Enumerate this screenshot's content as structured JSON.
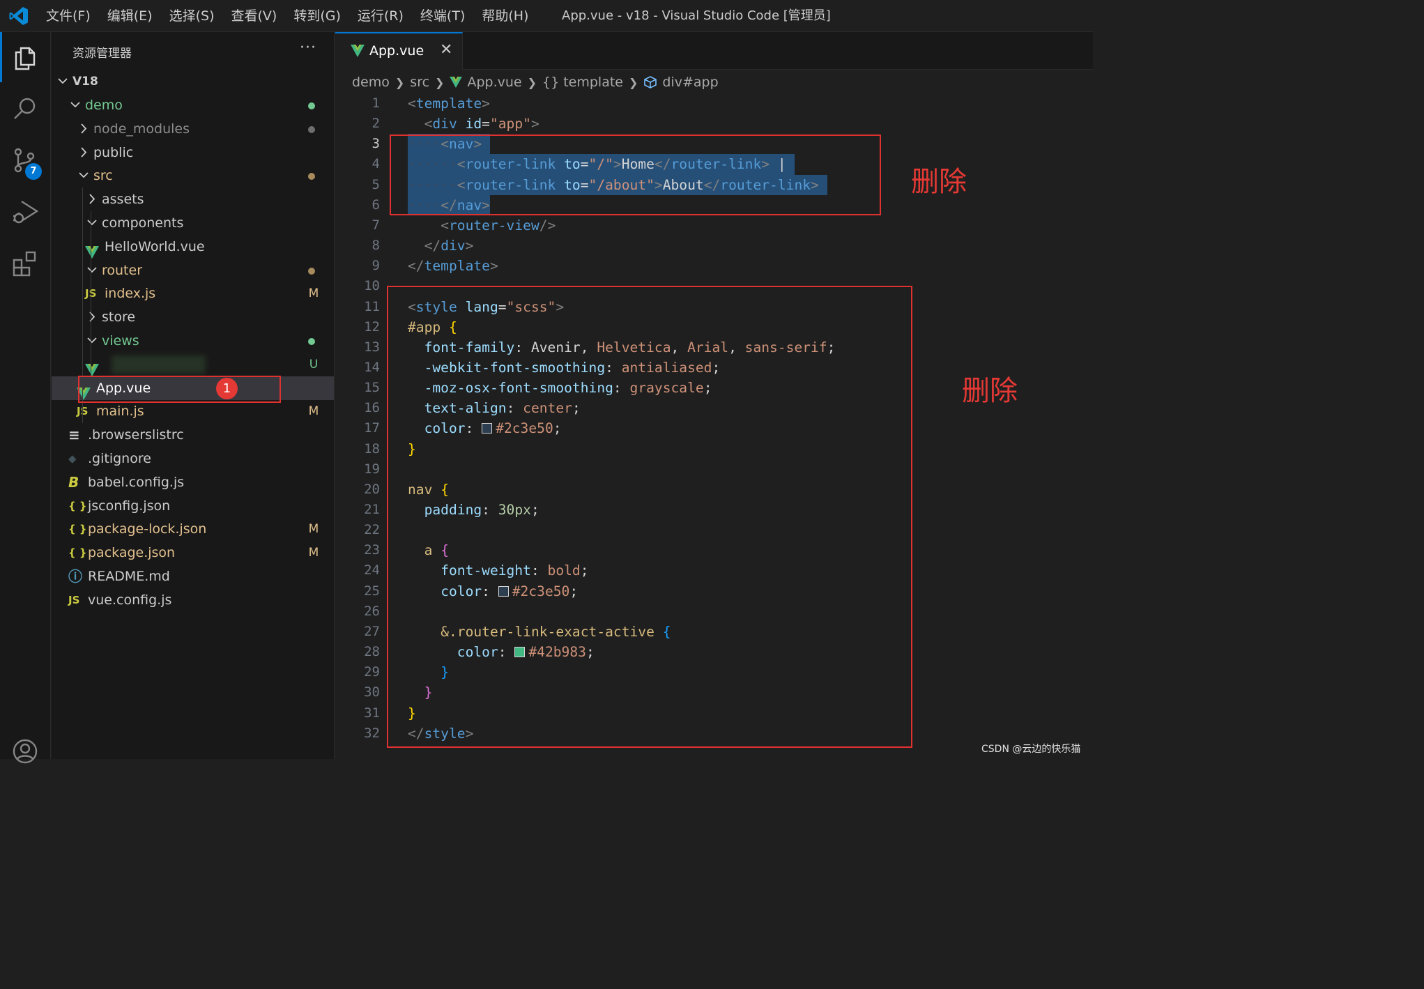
{
  "menu": [
    "文件(F)",
    "编辑(E)",
    "选择(S)",
    "查看(V)",
    "转到(G)",
    "运行(R)",
    "终端(T)",
    "帮助(H)"
  ],
  "window_title": "App.vue - v18 - Visual Studio Code [管理员]",
  "activity": {
    "scm_badge": "7"
  },
  "sidebar": {
    "title": "资源管理器",
    "more": "···",
    "root": "V18",
    "items": [
      {
        "label": "demo",
        "kind": "folder-open",
        "color": "#73c991",
        "deco": "dot",
        "deco_color": "#73c991"
      },
      {
        "label": "node_modules",
        "kind": "folder",
        "color": "#8c8c8c",
        "deco": "dot",
        "deco_color": "#6e6e6e"
      },
      {
        "label": "public",
        "kind": "folder",
        "color": "#cccccc"
      },
      {
        "label": "src",
        "kind": "folder-open",
        "color": "#e2c08d",
        "deco": "dot",
        "deco_color": "#a88b5c"
      },
      {
        "label": "assets",
        "kind": "folder",
        "color": "#cccccc"
      },
      {
        "label": "components",
        "kind": "folder-open",
        "color": "#cccccc"
      },
      {
        "label": "HelloWorld.vue",
        "kind": "vue",
        "color": "#cccccc"
      },
      {
        "label": "router",
        "kind": "folder-open",
        "color": "#e2c08d",
        "deco": "dot",
        "deco_color": "#a88b5c"
      },
      {
        "label": "index.js",
        "kind": "js",
        "color": "#e2c08d",
        "deco": "M",
        "deco_color": "#e2c08d"
      },
      {
        "label": "store",
        "kind": "folder",
        "color": "#cccccc"
      },
      {
        "label": "views",
        "kind": "folder-open",
        "color": "#73c991",
        "deco": "dot",
        "deco_color": "#73c991"
      },
      {
        "label": "",
        "kind": "vue",
        "color": "#73c991",
        "deco": "U",
        "deco_color": "#73c991"
      },
      {
        "label": "App.vue",
        "kind": "vue",
        "color": "#ffffff"
      },
      {
        "label": "main.js",
        "kind": "js",
        "color": "#e2c08d",
        "deco": "M",
        "deco_color": "#e2c08d"
      },
      {
        "label": ".browserslistrc",
        "kind": "lines",
        "color": "#cccccc"
      },
      {
        "label": ".gitignore",
        "kind": "git",
        "color": "#cccccc"
      },
      {
        "label": "babel.config.js",
        "kind": "babel",
        "color": "#cccccc"
      },
      {
        "label": "jsconfig.json",
        "kind": "json",
        "color": "#cccccc"
      },
      {
        "label": "package-lock.json",
        "kind": "json",
        "color": "#e2c08d",
        "deco": "M",
        "deco_color": "#e2c08d"
      },
      {
        "label": "package.json",
        "kind": "json",
        "color": "#e2c08d",
        "deco": "M",
        "deco_color": "#e2c08d"
      },
      {
        "label": "README.md",
        "kind": "info",
        "color": "#cccccc"
      },
      {
        "label": "vue.config.js",
        "kind": "js",
        "color": "#cccccc"
      }
    ],
    "marker": "1"
  },
  "editor": {
    "tab_label": "App.vue",
    "breadcrumb": [
      "demo",
      "src",
      "App.vue",
      "{} template",
      "div#app"
    ],
    "lines": [
      [
        [
          "tg",
          "<"
        ],
        [
          "tn",
          "template"
        ],
        [
          "tg",
          ">"
        ]
      ],
      [
        [
          "ws",
          "  "
        ],
        [
          "tg",
          "<"
        ],
        [
          "tn",
          "div"
        ],
        [
          "tx",
          " "
        ],
        [
          "at",
          "id"
        ],
        [
          "tx",
          "="
        ],
        [
          "st",
          "\"app\""
        ],
        [
          "tg",
          ">"
        ]
      ],
      [
        [
          "ws",
          "····"
        ],
        [
          "tg",
          "<"
        ],
        [
          "tn",
          "nav"
        ],
        [
          "tg",
          ">"
        ]
      ],
      [
        [
          "ws",
          "······"
        ],
        [
          "tg",
          "<"
        ],
        [
          "tn",
          "router-link"
        ],
        [
          "tx",
          " "
        ],
        [
          "at",
          "to"
        ],
        [
          "tx",
          "="
        ],
        [
          "st",
          "\"/\""
        ],
        [
          "tg",
          ">"
        ],
        [
          "tx",
          "Home"
        ],
        [
          "tg",
          "</"
        ],
        [
          "tn",
          "router-link"
        ],
        [
          "tg",
          ">"
        ],
        [
          "tx",
          " |"
        ]
      ],
      [
        [
          "ws",
          "······"
        ],
        [
          "tg",
          "<"
        ],
        [
          "tn",
          "router-link"
        ],
        [
          "tx",
          " "
        ],
        [
          "at",
          "to"
        ],
        [
          "tx",
          "="
        ],
        [
          "st",
          "\"/about\""
        ],
        [
          "tg",
          ">"
        ],
        [
          "tx",
          "About"
        ],
        [
          "tg",
          "</"
        ],
        [
          "tn",
          "router-link"
        ],
        [
          "tg",
          ">"
        ]
      ],
      [
        [
          "ws",
          "····"
        ],
        [
          "tg",
          "</"
        ],
        [
          "tn",
          "nav"
        ],
        [
          "tg",
          ">"
        ]
      ],
      [
        [
          "ws",
          "    "
        ],
        [
          "tg",
          "<"
        ],
        [
          "tn",
          "router-view"
        ],
        [
          "tg",
          "/>"
        ]
      ],
      [
        [
          "ws",
          "  "
        ],
        [
          "tg",
          "</"
        ],
        [
          "tn",
          "div"
        ],
        [
          "tg",
          ">"
        ]
      ],
      [
        [
          "tg",
          "</"
        ],
        [
          "tn",
          "template"
        ],
        [
          "tg",
          ">"
        ]
      ],
      [],
      [
        [
          "tg",
          "<"
        ],
        [
          "tn",
          "style"
        ],
        [
          "tx",
          " "
        ],
        [
          "at",
          "lang"
        ],
        [
          "tx",
          "="
        ],
        [
          "st",
          "\"scss\""
        ],
        [
          "tg",
          ">"
        ]
      ],
      [
        [
          "sel",
          "#app"
        ],
        [
          "tx",
          " "
        ],
        [
          "b1",
          "{"
        ]
      ],
      [
        [
          "ws",
          "  "
        ],
        [
          "pr",
          "font-family"
        ],
        [
          "tx",
          ": Avenir, "
        ],
        [
          "vl",
          "Helvetica"
        ],
        [
          "tx",
          ", "
        ],
        [
          "vl",
          "Arial"
        ],
        [
          "tx",
          ", "
        ],
        [
          "vl",
          "sans-serif"
        ],
        [
          "tx",
          ";"
        ]
      ],
      [
        [
          "ws",
          "  "
        ],
        [
          "pr",
          "-webkit-font-smoothing"
        ],
        [
          "tx",
          ": "
        ],
        [
          "vl",
          "antialiased"
        ],
        [
          "tx",
          ";"
        ]
      ],
      [
        [
          "ws",
          "  "
        ],
        [
          "pr",
          "-moz-osx-font-smoothing"
        ],
        [
          "tx",
          ": "
        ],
        [
          "vl",
          "grayscale"
        ],
        [
          "tx",
          ";"
        ]
      ],
      [
        [
          "ws",
          "  "
        ],
        [
          "pr",
          "text-align"
        ],
        [
          "tx",
          ": "
        ],
        [
          "vl",
          "center"
        ],
        [
          "tx",
          ";"
        ]
      ],
      [
        [
          "ws",
          "  "
        ],
        [
          "pr",
          "color"
        ],
        [
          "tx",
          ": "
        ],
        [
          "swatch",
          "#2c3e50"
        ],
        [
          "vl",
          "#2c3e50"
        ],
        [
          "tx",
          ";"
        ]
      ],
      [
        [
          "b1",
          "}"
        ]
      ],
      [],
      [
        [
          "sel",
          "nav"
        ],
        [
          "tx",
          " "
        ],
        [
          "b1",
          "{"
        ]
      ],
      [
        [
          "ws",
          "  "
        ],
        [
          "pr",
          "padding"
        ],
        [
          "tx",
          ": "
        ],
        [
          "nm",
          "30px"
        ],
        [
          "tx",
          ";"
        ]
      ],
      [],
      [
        [
          "ws",
          "  "
        ],
        [
          "sel",
          "a"
        ],
        [
          "tx",
          " "
        ],
        [
          "b2",
          "{"
        ]
      ],
      [
        [
          "ws",
          "    "
        ],
        [
          "pr",
          "font-weight"
        ],
        [
          "tx",
          ": "
        ],
        [
          "vl",
          "bold"
        ],
        [
          "tx",
          ";"
        ]
      ],
      [
        [
          "ws",
          "    "
        ],
        [
          "pr",
          "color"
        ],
        [
          "tx",
          ": "
        ],
        [
          "swatch",
          "#2c3e50"
        ],
        [
          "vl",
          "#2c3e50"
        ],
        [
          "tx",
          ";"
        ]
      ],
      [],
      [
        [
          "ws",
          "    "
        ],
        [
          "sel",
          "&.router-link-exact-active"
        ],
        [
          "tx",
          " "
        ],
        [
          "b3",
          "{"
        ]
      ],
      [
        [
          "ws",
          "      "
        ],
        [
          "pr",
          "color"
        ],
        [
          "tx",
          ": "
        ],
        [
          "swatch",
          "#42b983"
        ],
        [
          "vl",
          "#42b983"
        ],
        [
          "tx",
          ";"
        ]
      ],
      [
        [
          "ws",
          "    "
        ],
        [
          "b3",
          "}"
        ]
      ],
      [
        [
          "ws",
          "  "
        ],
        [
          "b2",
          "}"
        ]
      ],
      [
        [
          "b1",
          "}"
        ]
      ],
      [
        [
          "tg",
          "</"
        ],
        [
          "tn",
          "style"
        ],
        [
          "tg",
          ">"
        ]
      ]
    ],
    "active_line": 3
  },
  "annotations": {
    "delete_label_1": "删除",
    "delete_label_2": "删除"
  },
  "watermark": "CSDN @云边的快乐猫"
}
